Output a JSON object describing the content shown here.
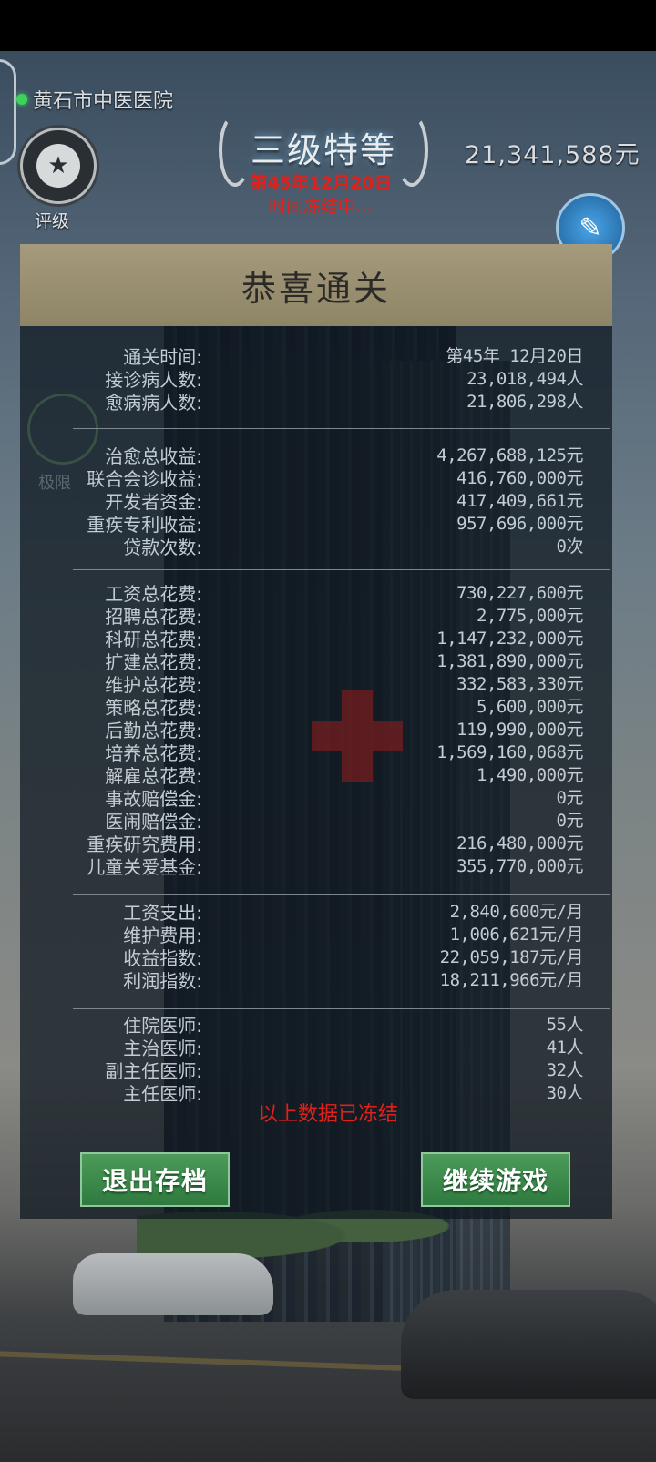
{
  "hospital_name": "黄石市中医医院",
  "rating_label": "评级",
  "grade": "三级特等",
  "date": "第45年12月20日",
  "time_status": "时间冻结中…",
  "money": "21,341,588元",
  "panel": {
    "title": "恭喜通关",
    "groups": [
      [
        {
          "label": "通关时间:",
          "value": "第45年 12月20日"
        },
        {
          "label": "接诊病人数:",
          "value": "23,018,494人"
        },
        {
          "label": "愈病病人数:",
          "value": "21,806,298人"
        }
      ],
      [
        {
          "label": "治愈总收益:",
          "value": "4,267,688,125元"
        },
        {
          "label": "联合会诊收益:",
          "value": "416,760,000元"
        },
        {
          "label": "开发者资金:",
          "value": "417,409,661元"
        },
        {
          "label": "重疾专利收益:",
          "value": "957,696,000元"
        },
        {
          "label": "贷款次数:",
          "value": "0次"
        }
      ],
      [
        {
          "label": "工资总花费:",
          "value": "730,227,600元"
        },
        {
          "label": "招聘总花费:",
          "value": "2,775,000元"
        },
        {
          "label": "科研总花费:",
          "value": "1,147,232,000元"
        },
        {
          "label": "扩建总花费:",
          "value": "1,381,890,000元"
        },
        {
          "label": "维护总花费:",
          "value": "332,583,330元"
        },
        {
          "label": "策略总花费:",
          "value": "5,600,000元"
        },
        {
          "label": "后勤总花费:",
          "value": "119,990,000元"
        },
        {
          "label": "培养总花费:",
          "value": "1,569,160,068元"
        },
        {
          "label": "解雇总花费:",
          "value": "1,490,000元"
        },
        {
          "label": "事故赔偿金:",
          "value": "0元"
        },
        {
          "label": "医闹赔偿金:",
          "value": "0元"
        },
        {
          "label": "重疾研究费用:",
          "value": "216,480,000元"
        },
        {
          "label": "儿童关爱基金:",
          "value": "355,770,000元"
        }
      ],
      [
        {
          "label": "工资支出:",
          "value": "2,840,600元/月"
        },
        {
          "label": "维护费用:",
          "value": "1,006,621元/月"
        },
        {
          "label": "收益指数:",
          "value": "22,059,187元/月"
        },
        {
          "label": "利润指数:",
          "value": "18,211,966元/月"
        }
      ],
      [
        {
          "label": "住院医师:",
          "value": "55人"
        },
        {
          "label": "主治医师:",
          "value": "41人"
        },
        {
          "label": "副主任医师:",
          "value": "32人"
        },
        {
          "label": "主任医师:",
          "value": "30人"
        }
      ]
    ]
  },
  "frozen_note": "以上数据已冻结",
  "buttons": {
    "exit": "退出存档",
    "continue": "继续游戏"
  },
  "ghost_label": "极限"
}
